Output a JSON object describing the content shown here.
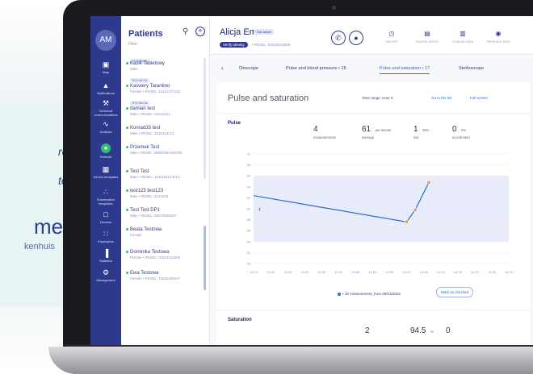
{
  "backdrop": {
    "line1": "re",
    "line2": "to",
    "line3": "met",
    "line4": "kenhuis"
  },
  "sidebar": {
    "avatar": "AM",
    "items": [
      {
        "label": "Map",
        "icon": "map-icon"
      },
      {
        "label": "Notifications",
        "icon": "bell-icon"
      },
      {
        "label": "Technical communications",
        "icon": "wrench-icon"
      },
      {
        "label": "Analysis",
        "icon": "chart-icon"
      },
      {
        "label": "Patients",
        "icon": "patients-icon",
        "active": true
      },
      {
        "label": "Device templates",
        "icon": "grid-icon"
      },
      {
        "label": "Examination templates",
        "icon": "tree-icon"
      },
      {
        "label": "Devices",
        "icon": "devices-icon"
      },
      {
        "label": "Employees",
        "icon": "employees-icon"
      },
      {
        "label": "Statistics",
        "icon": "bars-icon"
      },
      {
        "label": "Management",
        "icon": "gear-icon"
      }
    ]
  },
  "patients": {
    "title": "Patients",
    "filter": "Filter",
    "items": [
      {
        "tag": "TECHNICAL"
      },
      {
        "name": "Kazik Tabletowy",
        "meta": "Male",
        "tag": "TECHNICAL"
      },
      {
        "name": "Kaswery Tarantino",
        "meta": "Female • PESEL: 12121317133",
        "tag": "TECHNICAL"
      },
      {
        "name": "damian test",
        "meta": "Male • PESEL: 34141421"
      },
      {
        "name": "Konrad33 test",
        "meta": "Male • PESEL: 3131313113"
      },
      {
        "name": "Przemek Test",
        "meta": "Male • PESEL: 80987654456789"
      },
      {
        "name": "Test Test",
        "meta": "Male • PESEL: 1134151123214"
      },
      {
        "name": "test123 test123",
        "meta": "Male • PESEL: 3123123"
      },
      {
        "name": "Test Test DP1",
        "meta": "Male • PESEL: 88070000000"
      },
      {
        "name": "Beata Testowa",
        "meta": "Female"
      },
      {
        "name": "Dominika Testowa",
        "meta": "Female • PESEL: 01012312365"
      },
      {
        "name": "Ewa Testowa",
        "meta": "Female • PESEL: 72032209447"
      }
    ]
  },
  "header": {
    "name": "Alicja Em",
    "badge": "Not active",
    "verify": "Verify identity",
    "pesel": "• PESEL: 84020315858",
    "nav": [
      {
        "label": "HISTORY",
        "icon": "history-icon"
      },
      {
        "label": "PATIENT NOTES",
        "icon": "notes-icon"
      },
      {
        "label": "CLINICAL DATA",
        "icon": "clinical-icon"
      },
      {
        "label": "PERSONAL DATA",
        "icon": "person-icon"
      }
    ]
  },
  "tabs": [
    {
      "label": "Otoscope"
    },
    {
      "label": "Pulse and blood pressure • 15"
    },
    {
      "label": "Pulse and saturation • 17",
      "active": true
    },
    {
      "label": "Stethoscope"
    }
  ],
  "card": {
    "title": "Pulse and saturation",
    "range": "Time range: Hour ▾",
    "list": "Go to the list",
    "full": "Full screen",
    "pulse": {
      "title": "Pulse",
      "measurements": "4",
      "measurements_lbl": "measurements",
      "average": "61",
      "average_unit": "per minute",
      "average_lbl": "average",
      "low": "1",
      "low_unit": "25%",
      "low_lbl": "low",
      "acc": "0",
      "acc_unit": "0%",
      "acc_lbl": "accelerated"
    },
    "legend": "• 10 measurement_from 09/23/2022",
    "mark": "Mark as checked",
    "saturation": {
      "title": "Saturation",
      "count": "2",
      "value": "94.5",
      "value_unit": "%",
      "zero": "0"
    }
  },
  "chart_data": {
    "type": "line",
    "x": [
      "13:15",
      "13:20",
      "13:25",
      "13:30",
      "13:35",
      "13:40",
      "13:45",
      "13:50",
      "13:55",
      "14:00",
      "14:05",
      "14:10",
      "14:15",
      "14:20",
      "14:25",
      "14:30"
    ],
    "ylim": [
      50,
      70
    ],
    "yticks": [
      70,
      68,
      66,
      64,
      62,
      60,
      58,
      56,
      54,
      52,
      50
    ],
    "series": [
      {
        "points": [
          [
            0,
            62.4
          ],
          [
            9,
            57.6
          ],
          [
            9.5,
            59.8
          ],
          [
            10.3,
            64.8
          ]
        ],
        "color": "#2a6bd8"
      }
    ],
    "highlight_points": [
      1,
      2,
      3
    ],
    "band_color": "#e8ecfb"
  }
}
